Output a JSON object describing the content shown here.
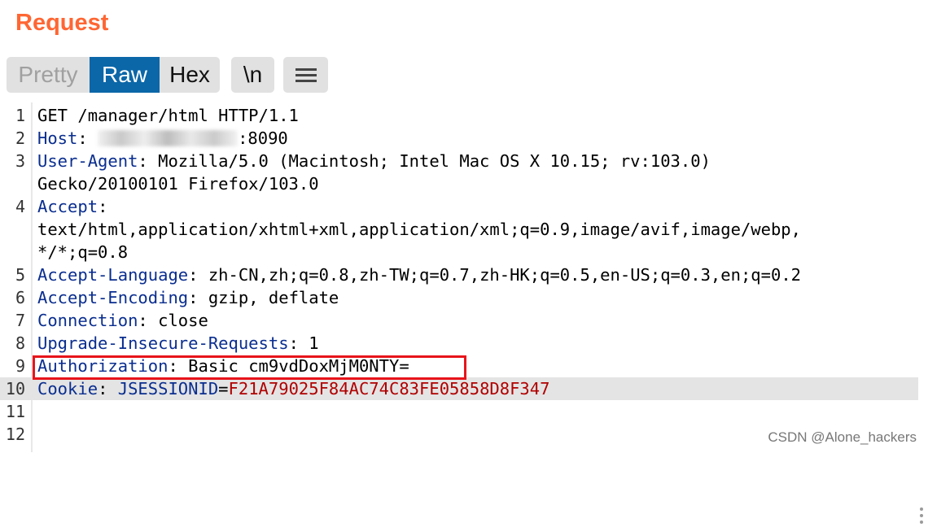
{
  "header": {
    "title": "Request"
  },
  "toolbar": {
    "pretty_label": "Pretty",
    "raw_label": "Raw",
    "hex_label": "Hex",
    "newline_label": "\\n",
    "menu_icon": "hamburger-menu-icon"
  },
  "editor": {
    "line_numbers": [
      "1",
      "2",
      "3",
      "4",
      "5",
      "6",
      "7",
      "8",
      "9",
      "10",
      "11",
      "12"
    ],
    "l1": "GET /manager/html HTTP/1.1",
    "l2": {
      "key": "Host",
      "sep": ": ",
      "value": ":8090"
    },
    "l3": {
      "key": "User-Agent",
      "sep": ": ",
      "value": "Mozilla/5.0 (Macintosh; Intel Mac OS X 10.15; rv:103.0)",
      "cont": "Gecko/20100101 Firefox/103.0"
    },
    "l4": {
      "key": "Accept",
      "sep": ":",
      "cont1": "text/html,application/xhtml+xml,application/xml;q=0.9,image/avif,image/webp,",
      "cont2": "*/*;q=0.8"
    },
    "l5": {
      "key": "Accept-Language",
      "sep": ": ",
      "value": "zh-CN,zh;q=0.8,zh-TW;q=0.7,zh-HK;q=0.5,en-US;q=0.3,en;q=0.2"
    },
    "l6": {
      "key": "Accept-Encoding",
      "sep": ": ",
      "value": "gzip, deflate"
    },
    "l7": {
      "key": "Connection",
      "sep": ": ",
      "value": "close"
    },
    "l8": {
      "key": "Upgrade-Insecure-Requests",
      "sep": ": ",
      "value": "1"
    },
    "l9": {
      "key": "Authorization",
      "sep": ": ",
      "value": "Basic cm9vdDoxMjM0NTY="
    },
    "l10": {
      "key": "Cookie",
      "sep": ": ",
      "ckey": "JSESSIONID",
      "eq": "=",
      "cval": "F21A79025F84AC74C83FE05858D8F347"
    }
  },
  "colors": {
    "title": "#ff6633",
    "active_tab": "#0b67a8",
    "header_key": "#0a2e8f",
    "cookie_value": "#b00000",
    "annotation_box": "#e8141b"
  },
  "watermark": "CSDN @Alone_hackers"
}
